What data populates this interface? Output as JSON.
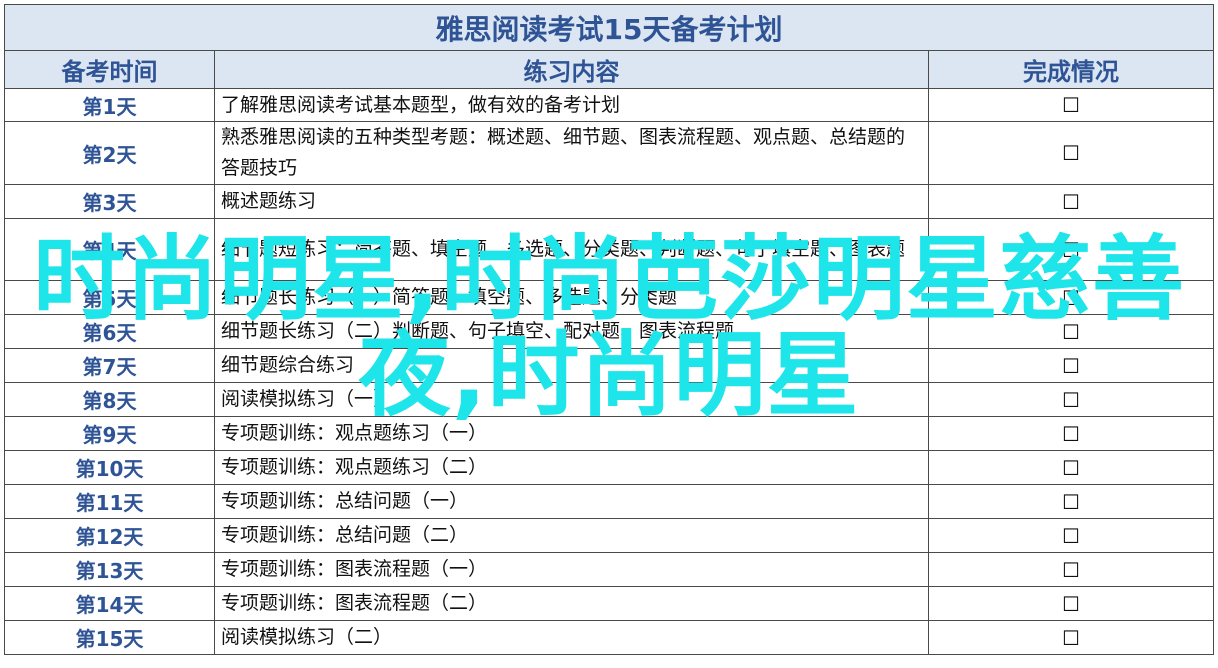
{
  "title": "雅思阅读考试15天备考计划",
  "headers": {
    "day": "备考时间",
    "content": "练习内容",
    "status": "完成情况"
  },
  "rows": [
    {
      "day": "第1天",
      "content": "了解雅思阅读考试基本题型，做有效的备考计划",
      "status": "☐"
    },
    {
      "day": "第2天",
      "content": "熟悉雅思阅读的五种类型考题：概述题、细节题、图表流程题、观点题、总结题的答题技巧",
      "status": "☐"
    },
    {
      "day": "第3天",
      "content": "概述题练习",
      "status": "☐"
    },
    {
      "day": "第4天",
      "content": "细节题短练习：简答题、填空题、多选题、分类题、判断题、句子填空题、图表题",
      "status": "☐"
    },
    {
      "day": "第5天",
      "content": "细节题长练习（一）简答题、填空题、多选题、分类题",
      "status": "☐"
    },
    {
      "day": "第6天",
      "content": "细节题长练习（二）判断题、句子填空、配对题、图表流程题",
      "status": "☐"
    },
    {
      "day": "第7天",
      "content": "细节题综合练习",
      "status": "☐"
    },
    {
      "day": "第8天",
      "content": "阅读模拟练习（一）",
      "status": "☐"
    },
    {
      "day": "第9天",
      "content": "专项题训练：观点题练习（一）",
      "status": "☐"
    },
    {
      "day": "第10天",
      "content": "专项题训练：观点题练习（二）",
      "status": "☐"
    },
    {
      "day": "第11天",
      "content": "专项题训练：总结问题（一）",
      "status": "☐"
    },
    {
      "day": "第12天",
      "content": "专项题训练：总结问题（二）",
      "status": "☐"
    },
    {
      "day": "第13天",
      "content": "专项题训练：图表流程题（一）",
      "status": "☐"
    },
    {
      "day": "第14天",
      "content": "专项题训练：图表流程题（二）",
      "status": "☐"
    },
    {
      "day": "第15天",
      "content": "阅读模拟练习（二）",
      "status": "☐"
    }
  ],
  "watermark": {
    "line1": "时尚明星,时尚芭莎明星慈善",
    "line2": "夜,时尚明星"
  }
}
